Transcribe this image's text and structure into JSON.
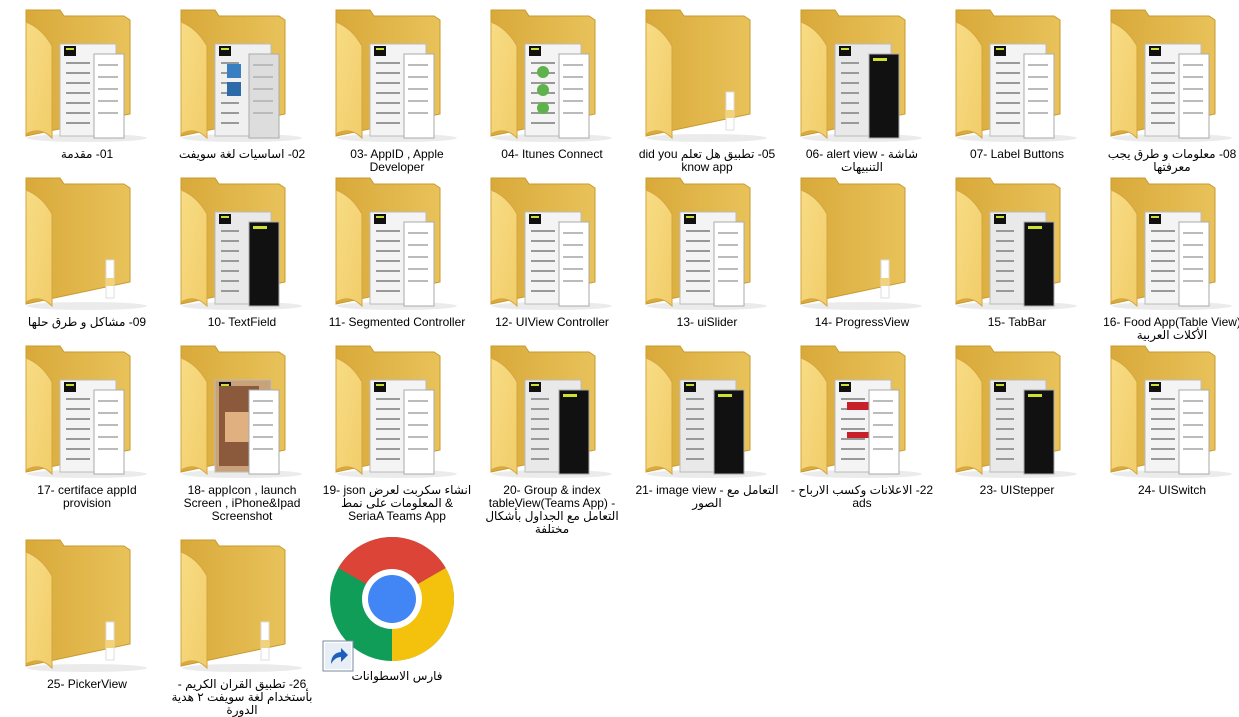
{
  "items": [
    {
      "label": "01- مقدمة",
      "kind": "folder",
      "preview": "light"
    },
    {
      "label": "02- اساسيات لغة سويفت",
      "kind": "folder",
      "preview": "mixed"
    },
    {
      "label": "03- AppID , Apple Developer",
      "kind": "folder",
      "preview": "light"
    },
    {
      "label": "04- Itunes Connect",
      "kind": "folder",
      "preview": "green"
    },
    {
      "label": "05- تطبيق هل تعلم did you know app",
      "kind": "folder",
      "preview": "none"
    },
    {
      "label": "06- alert view - شاشة التنبيهات",
      "kind": "folder",
      "preview": "dark"
    },
    {
      "label": "07- Label Buttons",
      "kind": "folder",
      "preview": "light"
    },
    {
      "label": "08- معلومات و طرق يجب معرفتها",
      "kind": "folder",
      "preview": "light"
    },
    {
      "label": "09- مشاكل و طرق حلها",
      "kind": "folder",
      "preview": "none"
    },
    {
      "label": "10- TextField",
      "kind": "folder",
      "preview": "dark"
    },
    {
      "label": "11- Segmented Controller",
      "kind": "folder",
      "preview": "light"
    },
    {
      "label": "12- UIView Controller",
      "kind": "folder",
      "preview": "light"
    },
    {
      "label": "13- uiSlider",
      "kind": "folder",
      "preview": "light"
    },
    {
      "label": "14- ProgressView",
      "kind": "folder",
      "preview": "none"
    },
    {
      "label": "15- TabBar",
      "kind": "folder",
      "preview": "dark"
    },
    {
      "label": "16- Food App(Table View) الأكلات العربية",
      "kind": "folder",
      "preview": "light"
    },
    {
      "label": "17- certiface appId provision",
      "kind": "folder",
      "preview": "light"
    },
    {
      "label": "18- appIcon , launch Screen , iPhone&Ipad Screenshot",
      "kind": "folder",
      "preview": "photo"
    },
    {
      "label": "19- json انشاء سكربت لعرض المعلومات على نمط & SeriaA Teams App",
      "kind": "folder",
      "preview": "light"
    },
    {
      "label": "20- Group & index tableView(Teams App) - التعامل مع الجداول بأشكال مختلفة",
      "kind": "folder",
      "preview": "dark"
    },
    {
      "label": "21- image view - التعامل مع الصور",
      "kind": "folder",
      "preview": "dark"
    },
    {
      "label": "22- الاعلانات وكسب الارباح - ads",
      "kind": "folder",
      "preview": "red"
    },
    {
      "label": "23- UIStepper",
      "kind": "folder",
      "preview": "dark"
    },
    {
      "label": "24- UISwitch",
      "kind": "folder",
      "preview": "light"
    },
    {
      "label": "25- PickerView",
      "kind": "folder",
      "preview": "none"
    },
    {
      "label": "26- تطبيق القران الكريم - بأستخدام لغة سويفت ٢ هدية الدورة",
      "kind": "folder",
      "preview": "none"
    },
    {
      "label": "فارس الاسطوانات",
      "kind": "chrome-shortcut",
      "preview": "none"
    }
  ],
  "colors": {
    "folder_back": "#e8c25a",
    "folder_front": "#f8dc84",
    "folder_edge": "#d9a93a",
    "chrome_red": "#db4437",
    "chrome_yellow": "#f4c20d",
    "chrome_green": "#0f9d58",
    "chrome_blue": "#4285f4"
  }
}
